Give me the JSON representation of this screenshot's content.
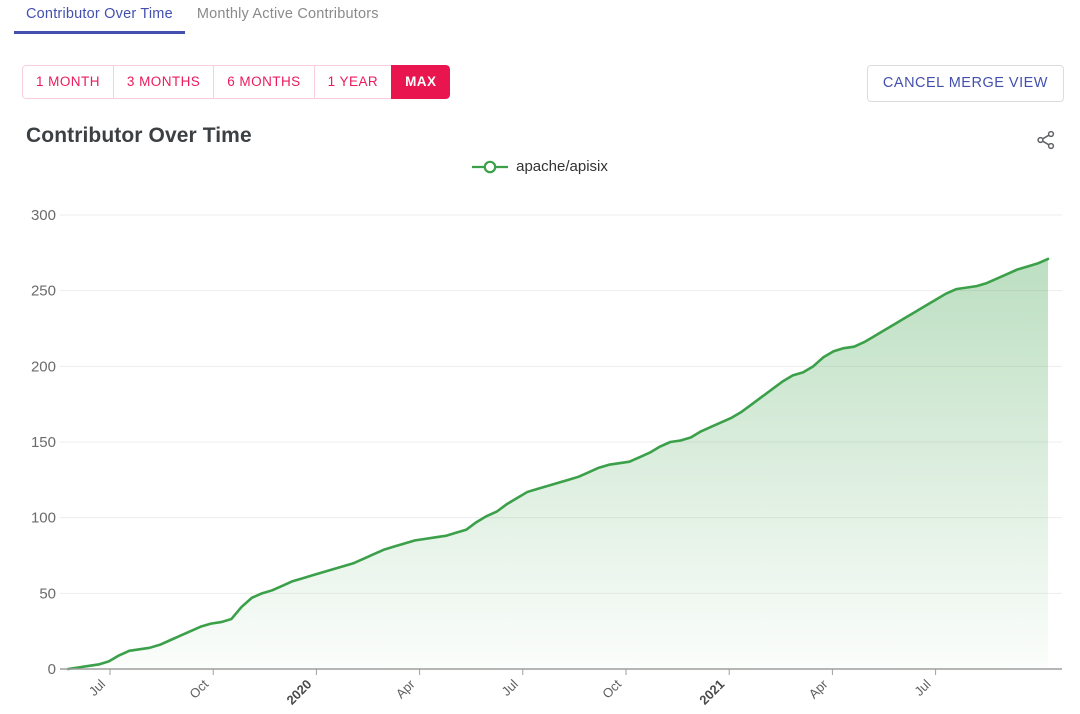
{
  "tabs": [
    {
      "label": "Contributor Over Time",
      "active": true
    },
    {
      "label": "Monthly Active Contributors",
      "active": false
    }
  ],
  "range_buttons": [
    {
      "label": "1 MONTH",
      "selected": false
    },
    {
      "label": "3 MONTHS",
      "selected": false
    },
    {
      "label": "6 MONTHS",
      "selected": false
    },
    {
      "label": "1 YEAR",
      "selected": false
    },
    {
      "label": "MAX",
      "selected": true
    }
  ],
  "cancel_merge_label": "CANCEL MERGE VIEW",
  "chart_title": "Contributor Over Time",
  "share_icon": "share-nodes-icon",
  "colors": {
    "accent_pink": "#e8154f",
    "accent_pink_light": "#f9cfdd",
    "tab_active": "#4350af",
    "tab_inactive": "#8a8a8a",
    "series_green": "#3ba049",
    "area_green_top": "rgba(59,160,73,0.33)",
    "area_green_bottom": "rgba(59,160,73,0.02)",
    "gridline": "#ededed",
    "axis": "#9e9e9e"
  },
  "chart_data": {
    "type": "area",
    "title": "Contributor Over Time",
    "xlabel": "",
    "ylabel": "",
    "ylim": [
      0,
      310
    ],
    "yticks": [
      0,
      50,
      100,
      150,
      200,
      250,
      300
    ],
    "grid": true,
    "legend_position": "top-center",
    "xticks": [
      "Jul",
      "Oct",
      "2020",
      "Apr",
      "Jul",
      "Oct",
      "2021",
      "Apr",
      "Jul"
    ],
    "xticks_bold": [
      "2020",
      "2021"
    ],
    "xticks_rotation_deg": -45,
    "series": [
      {
        "name": "apache/apisix",
        "color": "#3ba049",
        "x": [
          "2019-04",
          "2019-05",
          "2019-06",
          "2019-07",
          "2019-08",
          "2019-09",
          "2019-10",
          "2019-11",
          "2019-12",
          "2020-01",
          "2020-02",
          "2020-03",
          "2020-04",
          "2020-05",
          "2020-06",
          "2020-07",
          "2020-08",
          "2020-09",
          "2020-10",
          "2020-11",
          "2020-12",
          "2021-01",
          "2021-02",
          "2021-03",
          "2021-04",
          "2021-05",
          "2021-06",
          "2021-07",
          "2021-08"
        ],
        "values": [
          0,
          1,
          2,
          4,
          11,
          13,
          18,
          24,
          29,
          32,
          45,
          52,
          60,
          65,
          69,
          75,
          82,
          85,
          88,
          93,
          102,
          110,
          118,
          124,
          131,
          135,
          139,
          148,
          151,
          158,
          165,
          172,
          180,
          188,
          196,
          206,
          212,
          215,
          224,
          233,
          240,
          248,
          252,
          254,
          258,
          264,
          271
        ]
      }
    ],
    "series_points": [
      [
        0,
        0
      ],
      [
        12,
        1
      ],
      [
        24,
        2
      ],
      [
        36,
        3
      ],
      [
        48,
        5
      ],
      [
        60,
        9
      ],
      [
        72,
        12
      ],
      [
        84,
        13
      ],
      [
        96,
        14
      ],
      [
        108,
        16
      ],
      [
        120,
        19
      ],
      [
        132,
        22
      ],
      [
        144,
        25
      ],
      [
        156,
        28
      ],
      [
        168,
        30
      ],
      [
        180,
        31
      ],
      [
        192,
        33
      ],
      [
        204,
        41
      ],
      [
        216,
        47
      ],
      [
        228,
        50
      ],
      [
        240,
        52
      ],
      [
        252,
        55
      ],
      [
        264,
        58
      ],
      [
        276,
        60
      ],
      [
        288,
        62
      ],
      [
        300,
        64
      ],
      [
        312,
        66
      ],
      [
        324,
        68
      ],
      [
        336,
        70
      ],
      [
        348,
        73
      ],
      [
        360,
        76
      ],
      [
        372,
        79
      ],
      [
        384,
        81
      ],
      [
        396,
        83
      ],
      [
        408,
        85
      ],
      [
        420,
        86
      ],
      [
        432,
        87
      ],
      [
        444,
        88
      ],
      [
        456,
        90
      ],
      [
        468,
        92
      ],
      [
        480,
        97
      ],
      [
        492,
        101
      ],
      [
        504,
        104
      ],
      [
        516,
        109
      ],
      [
        528,
        113
      ],
      [
        540,
        117
      ],
      [
        552,
        119
      ],
      [
        564,
        121
      ],
      [
        576,
        123
      ],
      [
        588,
        125
      ],
      [
        600,
        127
      ],
      [
        612,
        130
      ],
      [
        624,
        133
      ],
      [
        636,
        135
      ],
      [
        648,
        136
      ],
      [
        660,
        137
      ],
      [
        672,
        140
      ],
      [
        684,
        143
      ],
      [
        696,
        147
      ],
      [
        708,
        150
      ],
      [
        720,
        151
      ],
      [
        732,
        153
      ],
      [
        744,
        157
      ],
      [
        756,
        160
      ],
      [
        768,
        163
      ],
      [
        780,
        166
      ],
      [
        792,
        170
      ],
      [
        804,
        175
      ],
      [
        816,
        180
      ],
      [
        828,
        185
      ],
      [
        840,
        190
      ],
      [
        852,
        194
      ],
      [
        864,
        196
      ],
      [
        876,
        200
      ],
      [
        888,
        206
      ],
      [
        900,
        210
      ],
      [
        912,
        212
      ],
      [
        924,
        213
      ],
      [
        936,
        216
      ],
      [
        948,
        220
      ],
      [
        960,
        224
      ],
      [
        972,
        228
      ],
      [
        984,
        232
      ],
      [
        996,
        236
      ],
      [
        1008,
        240
      ],
      [
        1020,
        244
      ],
      [
        1032,
        248
      ],
      [
        1044,
        251
      ],
      [
        1056,
        252
      ],
      [
        1068,
        253
      ],
      [
        1080,
        255
      ],
      [
        1092,
        258
      ],
      [
        1104,
        261
      ],
      [
        1116,
        264
      ],
      [
        1128,
        266
      ],
      [
        1140,
        268
      ],
      [
        1152,
        271
      ]
    ]
  }
}
